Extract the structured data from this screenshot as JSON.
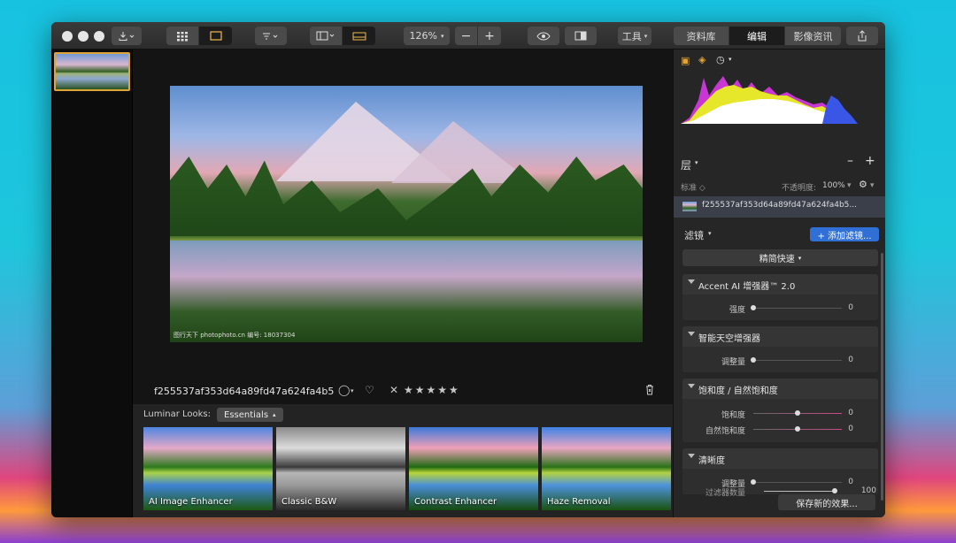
{
  "toolbar": {
    "zoom": "126%",
    "zoom_minus": "−",
    "zoom_plus": "+",
    "tools_label": "工具",
    "tabs": [
      {
        "label": "资料库"
      },
      {
        "label": "编辑"
      },
      {
        "label": "影像资讯"
      }
    ]
  },
  "image": {
    "filename": "f255537af353d64a89fd47a624fa4b5",
    "layer_name": "f255537af353d64a89fd47a624fa4b5...",
    "watermark": "图行天下 photophoto.cn  编号: 18037304"
  },
  "looks": {
    "header": "Luminar Looks:",
    "collection": "Essentials",
    "items": [
      {
        "label": "AI Image Enhancer"
      },
      {
        "label": "Classic B&W"
      },
      {
        "label": "Contrast Enhancer"
      },
      {
        "label": "Haze Removal"
      }
    ]
  },
  "panel": {
    "layers_title": "层",
    "blend_mode": "标准",
    "opacity_label": "不透明度:",
    "opacity_value": "100%",
    "filters_title": "滤镜",
    "add_filter": "+ 添加滤镜...",
    "fast_menu": "精简快速",
    "filters": [
      {
        "title": "Accent AI 增强器™ 2.0",
        "sliders": [
          {
            "label": "强度",
            "value": "0",
            "pos": 0
          }
        ]
      },
      {
        "title": "智能天空增强器",
        "sliders": [
          {
            "label": "调整量",
            "value": "0",
            "pos": 0
          }
        ]
      },
      {
        "title": "饱和度 / 自然饱和度",
        "sliders": [
          {
            "label": "饱和度",
            "value": "0",
            "pos": 0.5
          },
          {
            "label": "自然饱和度",
            "value": "0",
            "pos": 0.5
          }
        ]
      },
      {
        "title": "清晰度",
        "sliders": [
          {
            "label": "调整量",
            "value": "0",
            "pos": 0
          }
        ]
      }
    ],
    "filter_amount_label": "过滤器数量",
    "filter_amount_value": "100",
    "save_button": "保存新的效果..."
  },
  "colors": {
    "accent_blue": "#2f6fd6",
    "selection_orange": "#e0a53a",
    "window_bg": "#161616",
    "panel_bg": "#262626"
  }
}
